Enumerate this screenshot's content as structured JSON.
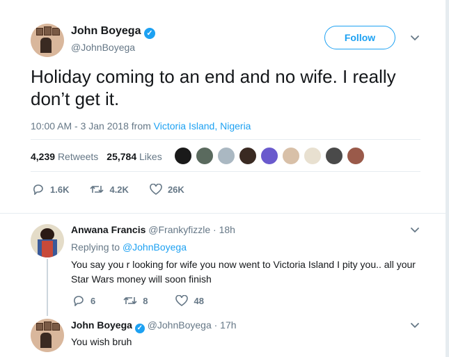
{
  "tweet": {
    "author_name": "John Boyega",
    "author_handle": "@JohnBoyega",
    "follow_label": "Follow",
    "text": "Holiday coming to an end and no wife. I really don’t get it.",
    "time": "10:00 AM - 3 Jan 2018 from",
    "location": "Victoria Island, Nigeria",
    "retweets_count": "4,239",
    "retweets_label": "Retweets",
    "likes_count": "25,784",
    "likes_label": "Likes",
    "liker_colors": [
      "#1a1a1a",
      "#5a6a5e",
      "#aab8c2",
      "#3a2a22",
      "#6a5acd",
      "#d8c0a8",
      "#e8e0d0",
      "#4a4a4a",
      "#9a5a4a"
    ],
    "reply_count": "1.6K",
    "retweet_action_count": "4.2K",
    "like_action_count": "26K"
  },
  "replies": [
    {
      "name": "Anwana Francis",
      "handle": "@Frankyfizzle · 18h",
      "replying_prefix": "Replying to",
      "replying_handle": "@JohnBoyega",
      "text": "You say you r looking for wife you now went to Victoria Island I pity you.. all your Star Wars money will soon finish",
      "reply_count": "6",
      "retweet_count": "8",
      "like_count": "48"
    },
    {
      "name": "John Boyega",
      "handle": "@JohnBoyega · 17h",
      "text": "You wish bruh"
    }
  ],
  "colors": {
    "accent": "#1da1f2",
    "muted": "#657786",
    "text": "#14171a"
  }
}
